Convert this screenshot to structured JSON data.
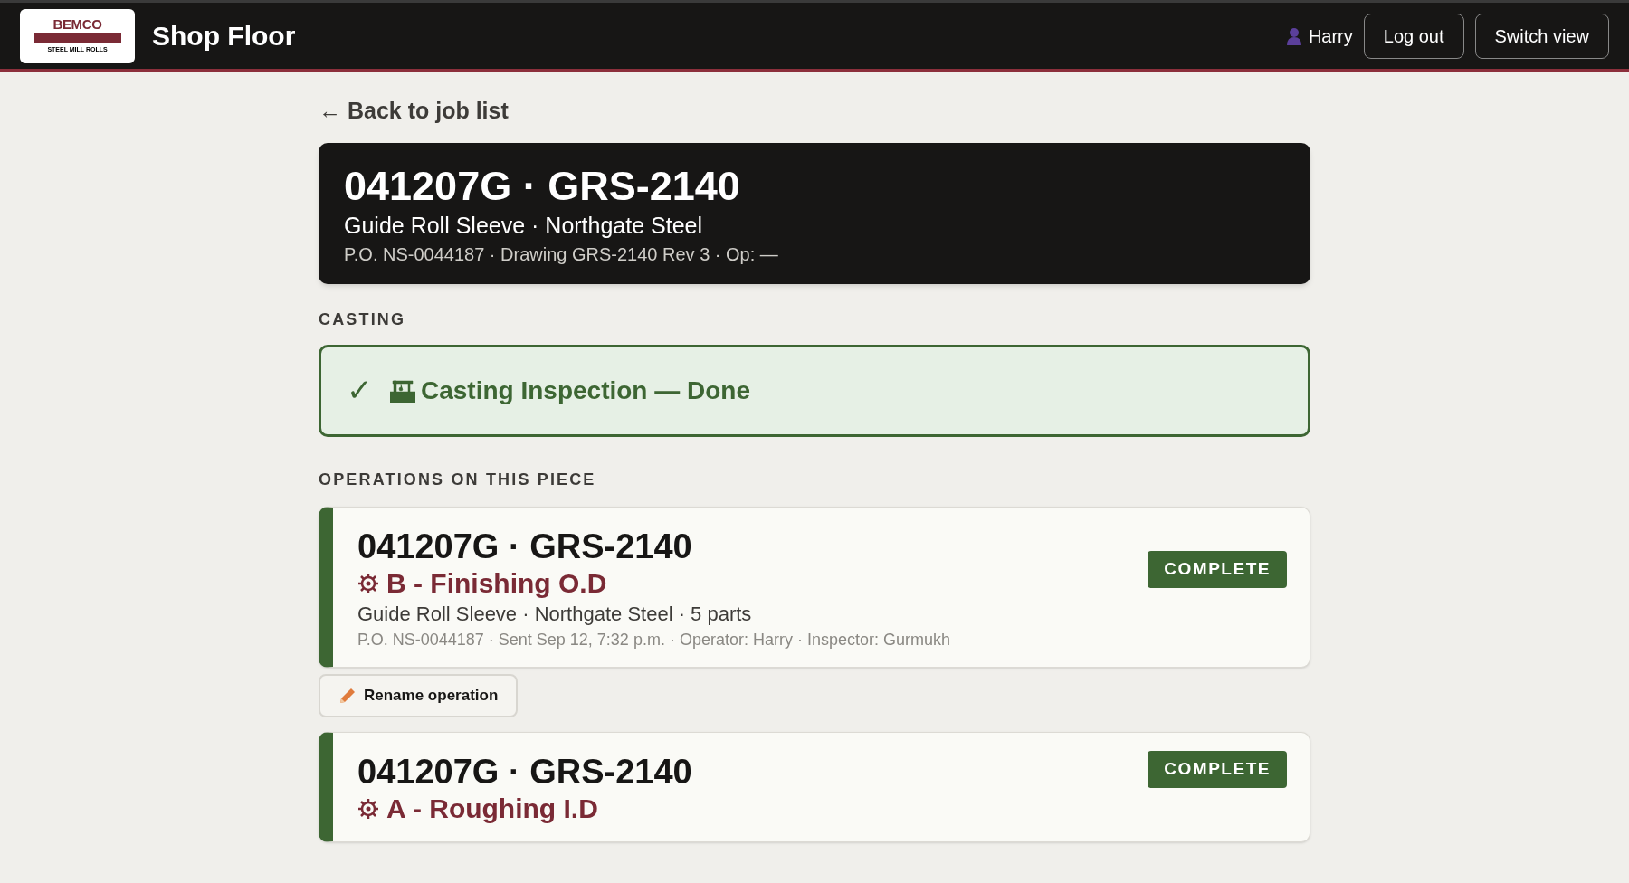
{
  "header": {
    "logo": {
      "name": "BEMCO",
      "subtitle": "STEEL MILL ROLLS"
    },
    "title": "Shop Floor",
    "user": "Harry",
    "buttons": [
      "Log out",
      "Switch view"
    ]
  },
  "back_link": "← Back to job list",
  "job": {
    "title": "041207G · GRS-2140",
    "subtitle": "Guide Roll Sleeve · Northgate Steel",
    "meta": "P.O. NS-0044187 · Drawing GRS-2140 Rev 3 · Op: —"
  },
  "casting": {
    "heading": "CASTING",
    "check": "✓",
    "label": "Casting Inspection — Done",
    "done": true
  },
  "operations": {
    "heading": "OPERATIONS ON THIS PIECE",
    "items": [
      {
        "title": "041207G · GRS-2140",
        "name": "B - Finishing O.D",
        "details": "Guide Roll Sleeve · Northgate Steel · 5 parts",
        "meta": "P.O. NS-0044187 · Sent Sep 12, 7:32 p.m. · Operator: Harry · Inspector: Gurmukh",
        "status": "COMPLETE",
        "color": "#3d6633",
        "action": "Rename operation"
      },
      {
        "title": "041207G · GRS-2140",
        "name": "A - Roughing I.D",
        "status": "COMPLETE",
        "color": "#3d6633"
      }
    ]
  }
}
